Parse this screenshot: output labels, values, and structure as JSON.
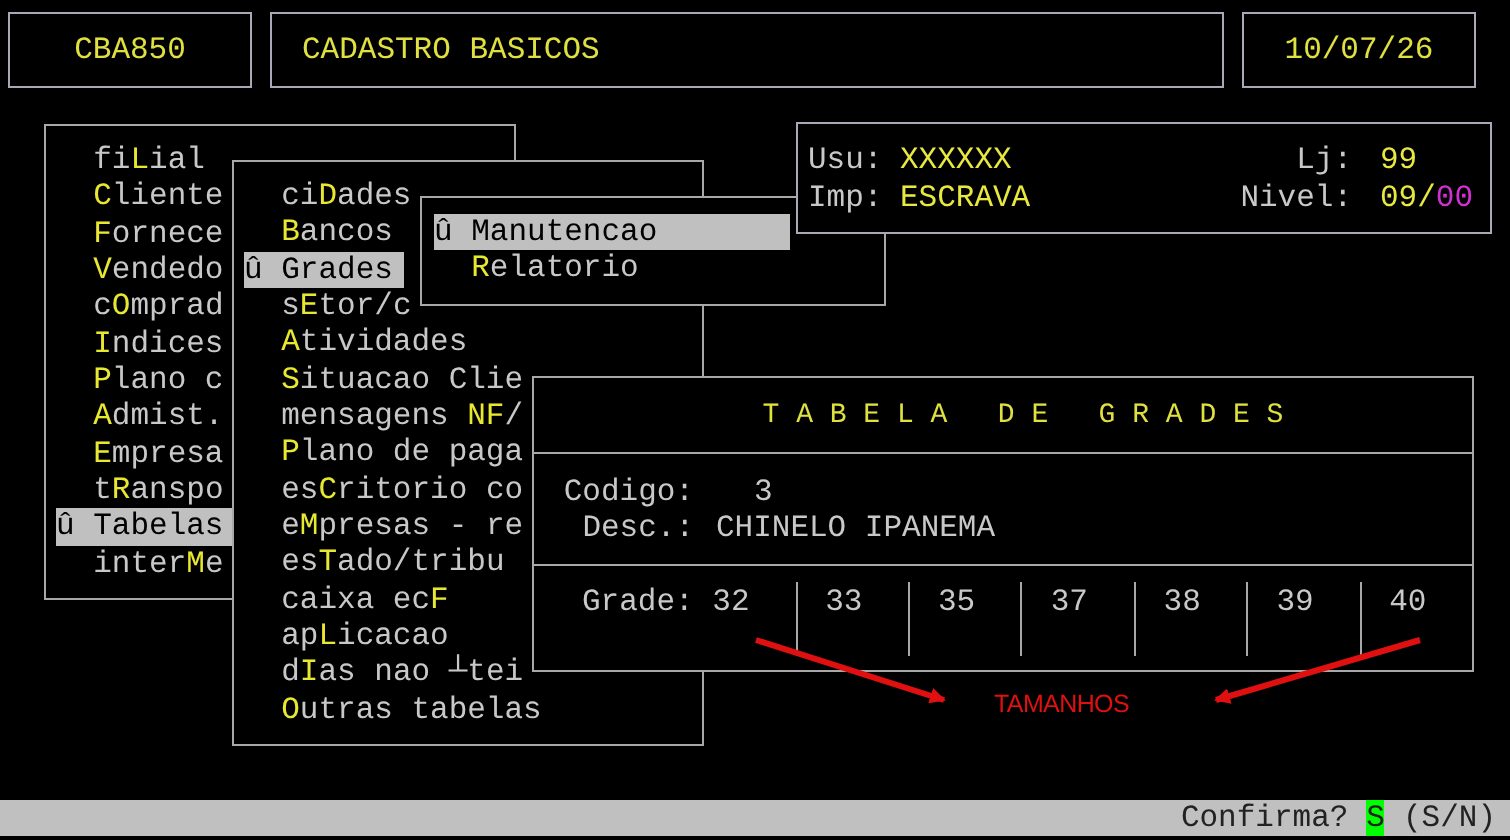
{
  "header": {
    "program": "CBA850",
    "title": "CADASTRO BASICOS",
    "date": "10/07/26"
  },
  "menus": [
    {
      "marker": "û",
      "items": [
        {
          "pre": "fi",
          "key": "L",
          "post": "ial",
          "selected": false
        },
        {
          "key": "C",
          "post": "liente",
          "selected": false
        },
        {
          "key": "F",
          "post": "ornece",
          "selected": false
        },
        {
          "key": "V",
          "post": "endedo",
          "selected": false
        },
        {
          "pre": "c",
          "key": "O",
          "post": "mprad",
          "selected": false
        },
        {
          "key": "I",
          "post": "ndices",
          "selected": false
        },
        {
          "key": "P",
          "post": "lano c",
          "selected": false
        },
        {
          "key": "A",
          "post": "dmist.",
          "selected": false
        },
        {
          "key": "E",
          "post": "mpresa",
          "selected": false
        },
        {
          "pre": "t",
          "key": "R",
          "post": "anspo",
          "selected": false
        },
        {
          "pre": "Tabelas",
          "selected": true
        },
        {
          "pre": "inter",
          "key": "M",
          "post": "e",
          "selected": false
        }
      ]
    },
    {
      "marker": "û",
      "items": [
        {
          "pre": "ci",
          "key": "D",
          "post": "ades",
          "selected": false
        },
        {
          "key": "B",
          "post": "ancos",
          "selected": false
        },
        {
          "pre": "Grades",
          "selected": true
        },
        {
          "pre": "s",
          "key": "E",
          "post": "tor/c",
          "selected": false
        },
        {
          "key": "A",
          "post": "tividades",
          "selected": false
        },
        {
          "key": "S",
          "post": "ituacao Clie",
          "selected": false
        },
        {
          "pre": "mensagens ",
          "key": "NF",
          "post": "/",
          "selected": false
        },
        {
          "key": "P",
          "post": "lano de paga",
          "selected": false
        },
        {
          "pre": "es",
          "key": "C",
          "post": "ritorio co",
          "selected": false
        },
        {
          "pre": "e",
          "key": "M",
          "post": "presas - re",
          "selected": false
        },
        {
          "pre": "es",
          "key": "T",
          "post": "ado/tribu",
          "selected": false
        },
        {
          "pre": "caixa ec",
          "key": "F",
          "selected": false
        },
        {
          "pre": "ap",
          "key": "L",
          "post": "icacao",
          "selected": false
        },
        {
          "pre": "d",
          "key": "I",
          "post": "as nao ┴tei",
          "selected": false
        },
        {
          "key": "O",
          "post": "utras tabelas",
          "selected": false
        }
      ]
    },
    {
      "marker": "û",
      "items": [
        {
          "pre": "Manutencao",
          "selected": true
        },
        {
          "key": "R",
          "post": "elatorio",
          "selected": false
        }
      ]
    }
  ],
  "session": {
    "user_label": "Usu:",
    "user": "XXXXXX",
    "store_label": "Lj:",
    "store": "99",
    "printer_label": "Imp:",
    "printer": "ESCRAVA",
    "level_label": "Nivel:",
    "level_value": "09/",
    "level_extra": "00"
  },
  "grade_table": {
    "title": "T A B E L A   D E   G R A D E S",
    "fields": [
      {
        "kind": "number",
        "label": "Codigo:",
        "value": "3"
      },
      {
        "kind": "text",
        "label": "Desc.:",
        "value": "CHINELO IPANEMA"
      }
    ],
    "grade_label": "Grade:",
    "sizes": [
      "32",
      "33",
      "35",
      "37",
      "38",
      "39",
      "40"
    ]
  },
  "annotation": {
    "label": "TAMANHOS"
  },
  "status_bar": {
    "prompt": "Confirma?",
    "answer": "S",
    "options": "(S/N)"
  }
}
